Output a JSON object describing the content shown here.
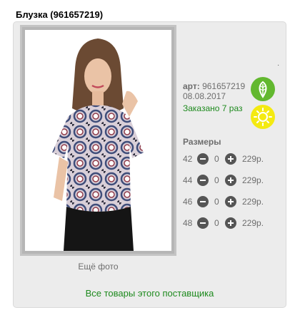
{
  "title": "Блузка (961657219)",
  "product": {
    "art_label": "арт:",
    "art": "961657219",
    "date": "08.08.2017",
    "ordered": "Заказано 7 раз"
  },
  "photo": {
    "more_label": "Ещё фото"
  },
  "sizes": {
    "title": "Размеры",
    "rows": [
      {
        "size": "42",
        "qty": "0",
        "price": "229р."
      },
      {
        "size": "44",
        "qty": "0",
        "price": "229р."
      },
      {
        "size": "46",
        "qty": "0",
        "price": "229р."
      },
      {
        "size": "48",
        "qty": "0",
        "price": "229р."
      }
    ]
  },
  "supplier_link": "Все товары этого поставщика",
  "icons": {
    "eco": "leaf-icon",
    "season": "sun-icon"
  },
  "colors": {
    "green_text": "#1e8a1e",
    "leaf_badge": "#62b82f",
    "sun_badge": "#f4ea12"
  }
}
